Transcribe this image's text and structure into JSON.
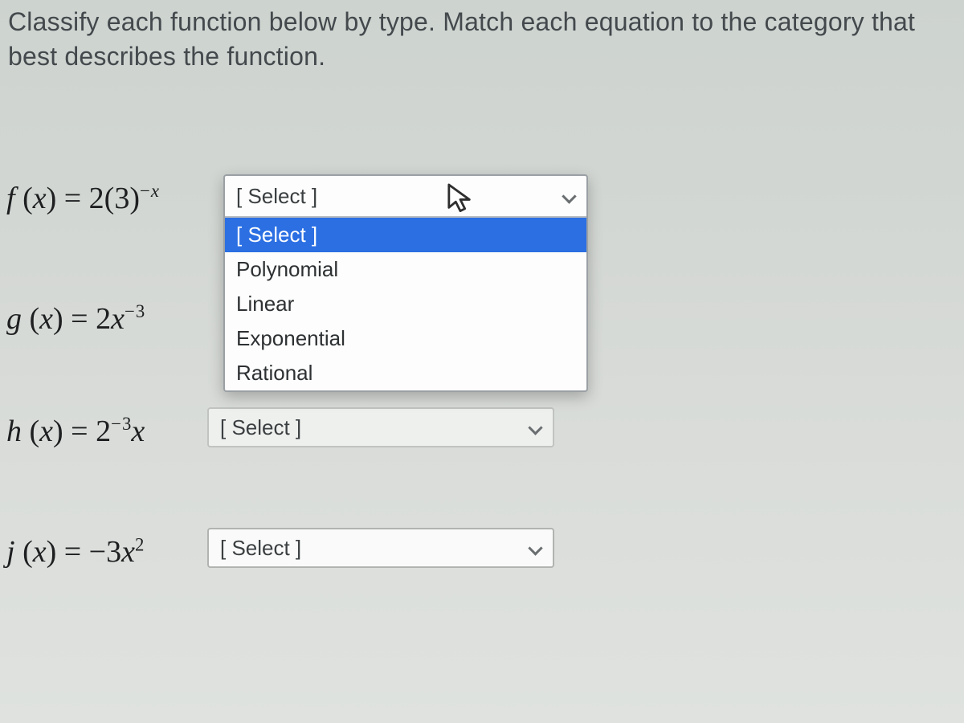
{
  "instructions": "Classify each function below by type. Match each equation to the category that best describes the function.",
  "placeholder": "[ Select ]",
  "options": {
    "placeholder": "[ Select ]",
    "polynomial": "Polynomial",
    "linear": "Linear",
    "exponential": "Exponential",
    "rational": "Rational"
  },
  "functions": {
    "f": {
      "name": "f",
      "display_html": "f (x) = 2(3)^{-x}"
    },
    "g": {
      "name": "g",
      "display_html": "g (x) = 2x^{-3}"
    },
    "h": {
      "name": "h",
      "display_html": "h (x) = 2^{-3}x"
    },
    "j": {
      "name": "j",
      "display_html": "j (x) = -3x^{2}"
    }
  }
}
